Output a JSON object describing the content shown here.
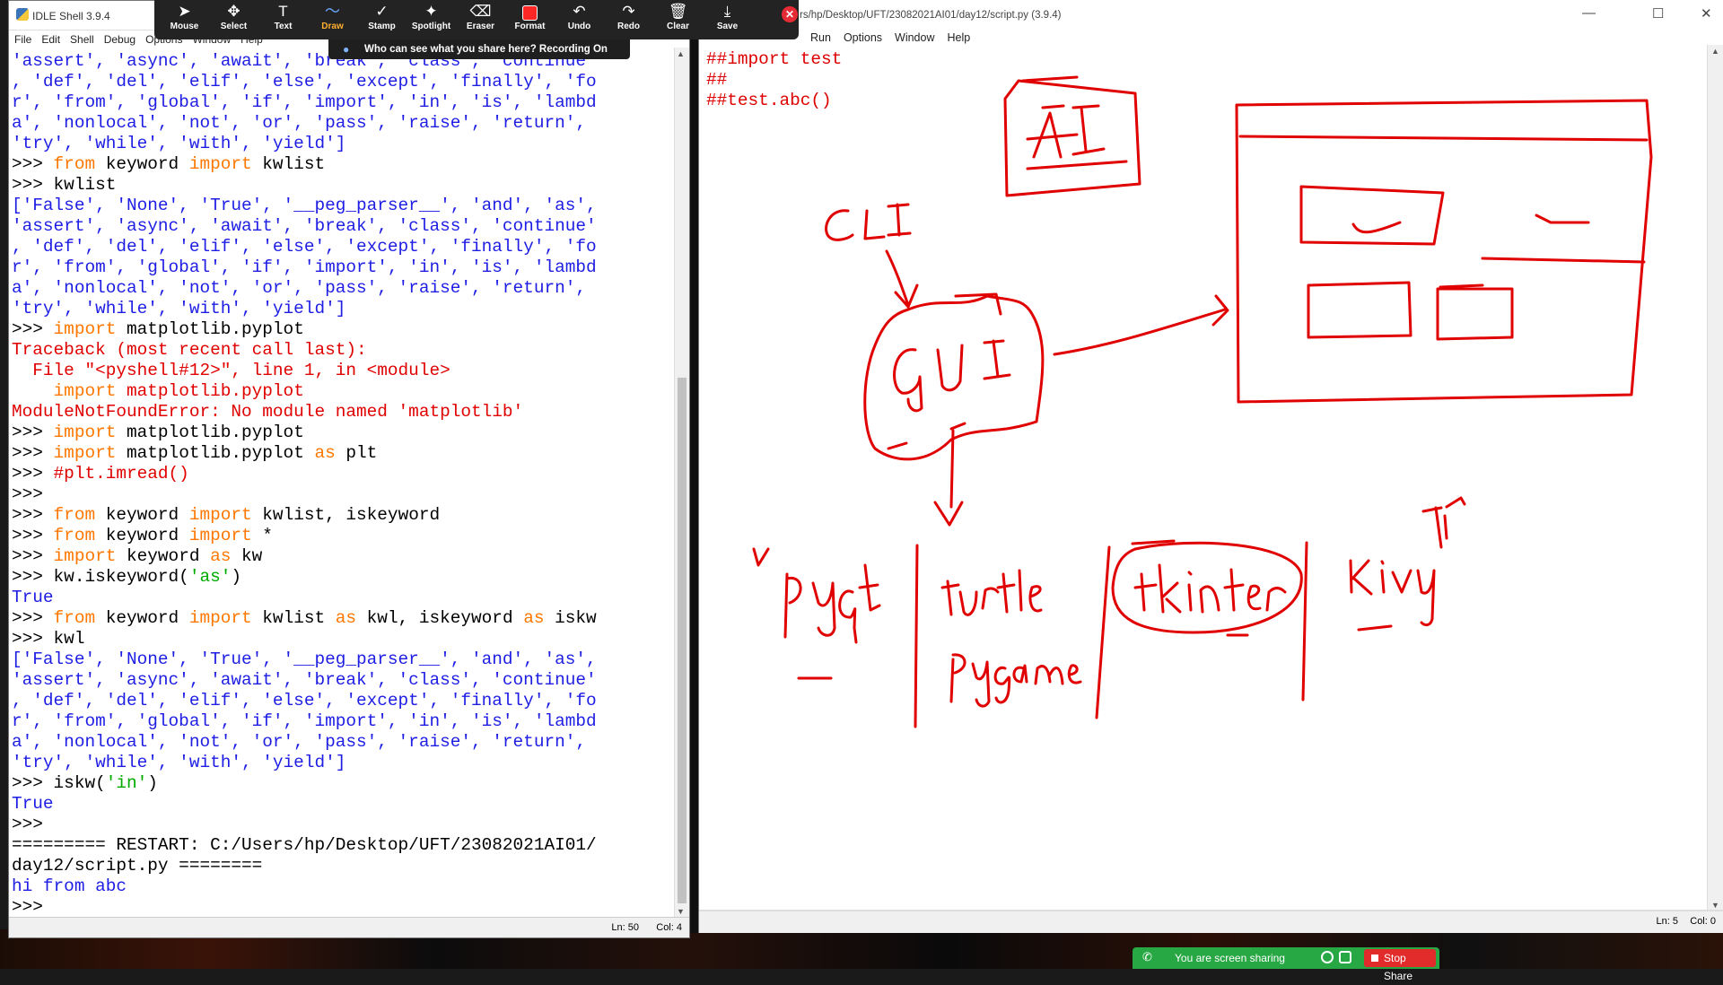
{
  "shell_window": {
    "title": "IDLE Shell 3.9.4",
    "menu": [
      "File",
      "Edit",
      "Shell",
      "Debug",
      "Options",
      "Window",
      "Help"
    ],
    "lines": [
      [
        {
          "t": "'assert', 'async', 'await', 'break', 'class', 'continue'",
          "c": "out"
        }
      ],
      [
        {
          "t": ", 'def', 'del', 'elif', 'else', 'except', 'finally', 'fo",
          "c": "out"
        }
      ],
      [
        {
          "t": "r', 'from', 'global', 'if', 'import', 'in', 'is', 'lambd",
          "c": "out"
        }
      ],
      [
        {
          "t": "a', 'nonlocal', 'not', 'or', 'pass', 'raise', 'return',",
          "c": "out"
        }
      ],
      [
        {
          "t": "'try', 'while', 'with', 'yield']",
          "c": "out"
        }
      ],
      [
        {
          "t": ">>> ",
          "c": "plain"
        },
        {
          "t": "from",
          "c": "kw"
        },
        {
          "t": " keyword ",
          "c": "plain"
        },
        {
          "t": "import",
          "c": "kw"
        },
        {
          "t": " kwlist",
          "c": "plain"
        }
      ],
      [
        {
          "t": ">>> kwlist",
          "c": "plain"
        }
      ],
      [
        {
          "t": "['False', 'None', 'True', '__peg_parser__', 'and', 'as',",
          "c": "out"
        }
      ],
      [
        {
          "t": "'assert', 'async', 'await', 'break', 'class', 'continue'",
          "c": "out"
        }
      ],
      [
        {
          "t": ", 'def', 'del', 'elif', 'else', 'except', 'finally', 'fo",
          "c": "out"
        }
      ],
      [
        {
          "t": "r', 'from', 'global', 'if', 'import', 'in', 'is', 'lambd",
          "c": "out"
        }
      ],
      [
        {
          "t": "a', 'nonlocal', 'not', 'or', 'pass', 'raise', 'return',",
          "c": "out"
        }
      ],
      [
        {
          "t": "'try', 'while', 'with', 'yield']",
          "c": "out"
        }
      ],
      [
        {
          "t": ">>> ",
          "c": "plain"
        },
        {
          "t": "import",
          "c": "kw"
        },
        {
          "t": " matplotlib.pyplot",
          "c": "plain"
        }
      ],
      [
        {
          "t": "Traceback (most recent call last):",
          "c": "err"
        }
      ],
      [
        {
          "t": "  File \"<pyshell#12>\", line 1, in <module>",
          "c": "err"
        }
      ],
      [
        {
          "t": "    ",
          "c": "plain"
        },
        {
          "t": "import",
          "c": "kw"
        },
        {
          "t": " matplotlib.pyplot",
          "c": "err"
        }
      ],
      [
        {
          "t": "ModuleNotFoundError: No module named 'matplotlib'",
          "c": "err"
        }
      ],
      [
        {
          "t": ">>> ",
          "c": "plain"
        },
        {
          "t": "import",
          "c": "kw"
        },
        {
          "t": " matplotlib.pyplot",
          "c": "plain"
        }
      ],
      [
        {
          "t": ">>> ",
          "c": "plain"
        },
        {
          "t": "import",
          "c": "kw"
        },
        {
          "t": " matplotlib.pyplot ",
          "c": "plain"
        },
        {
          "t": "as",
          "c": "kw"
        },
        {
          "t": " plt",
          "c": "plain"
        }
      ],
      [
        {
          "t": ">>> ",
          "c": "plain"
        },
        {
          "t": "#plt.imread()",
          "c": "err"
        }
      ],
      [
        {
          "t": ">>> ",
          "c": "plain"
        }
      ],
      [
        {
          "t": ">>> ",
          "c": "plain"
        },
        {
          "t": "from",
          "c": "kw"
        },
        {
          "t": " keyword ",
          "c": "plain"
        },
        {
          "t": "import",
          "c": "kw"
        },
        {
          "t": " kwlist, iskeyword",
          "c": "plain"
        }
      ],
      [
        {
          "t": ">>> ",
          "c": "plain"
        },
        {
          "t": "from",
          "c": "kw"
        },
        {
          "t": " keyword ",
          "c": "plain"
        },
        {
          "t": "import",
          "c": "kw"
        },
        {
          "t": " *",
          "c": "plain"
        }
      ],
      [
        {
          "t": ">>> ",
          "c": "plain"
        },
        {
          "t": "import",
          "c": "kw"
        },
        {
          "t": " keyword ",
          "c": "plain"
        },
        {
          "t": "as",
          "c": "kw"
        },
        {
          "t": " kw",
          "c": "plain"
        }
      ],
      [
        {
          "t": ">>> kw.iskeyword(",
          "c": "plain"
        },
        {
          "t": "'as'",
          "c": "str"
        },
        {
          "t": ")",
          "c": "plain"
        }
      ],
      [
        {
          "t": "True",
          "c": "out"
        }
      ],
      [
        {
          "t": ">>> ",
          "c": "plain"
        },
        {
          "t": "from",
          "c": "kw"
        },
        {
          "t": " keyword ",
          "c": "plain"
        },
        {
          "t": "import",
          "c": "kw"
        },
        {
          "t": " kwlist ",
          "c": "plain"
        },
        {
          "t": "as",
          "c": "kw"
        },
        {
          "t": " kwl, iskeyword ",
          "c": "plain"
        },
        {
          "t": "as",
          "c": "kw"
        },
        {
          "t": " iskw",
          "c": "plain"
        }
      ],
      [
        {
          "t": ">>> kwl",
          "c": "plain"
        }
      ],
      [
        {
          "t": "['False', 'None', 'True', '__peg_parser__', 'and', 'as',",
          "c": "out"
        }
      ],
      [
        {
          "t": "'assert', 'async', 'await', 'break', 'class', 'continue'",
          "c": "out"
        }
      ],
      [
        {
          "t": ", 'def', 'del', 'elif', 'else', 'except', 'finally', 'fo",
          "c": "out"
        }
      ],
      [
        {
          "t": "r', 'from', 'global', 'if', 'import', 'in', 'is', 'lambd",
          "c": "out"
        }
      ],
      [
        {
          "t": "a', 'nonlocal', 'not', 'or', 'pass', 'raise', 'return',",
          "c": "out"
        }
      ],
      [
        {
          "t": "'try', 'while', 'with', 'yield']",
          "c": "out"
        }
      ],
      [
        {
          "t": ">>> iskw(",
          "c": "plain"
        },
        {
          "t": "'in'",
          "c": "str"
        },
        {
          "t": ")",
          "c": "plain"
        }
      ],
      [
        {
          "t": "True",
          "c": "out"
        }
      ],
      [
        {
          "t": ">>> ",
          "c": "plain"
        }
      ],
      [
        {
          "t": "========= RESTART: C:/Users/hp/Desktop/UFT/23082021AI01/",
          "c": "plain"
        }
      ],
      [
        {
          "t": "day12/script.py ========",
          "c": "plain"
        }
      ],
      [
        {
          "t": "hi from abc",
          "c": "out"
        }
      ],
      [
        {
          "t": ">>> ",
          "c": "plain"
        }
      ]
    ],
    "status": {
      "ln": "Ln: 50",
      "col": "Col: 4"
    }
  },
  "editor_window": {
    "title": "rs/hp/Desktop/UFT/23082021AI01/day12/script.py (3.9.4)",
    "menu": [
      "Run",
      "Options",
      "Window",
      "Help"
    ],
    "code_lines": [
      "##import test",
      "##",
      "##test.abc()"
    ],
    "status": {
      "ln": "Ln: 5",
      "col": "Col: 0"
    }
  },
  "annotations": {
    "handwritten_labels": [
      "AI",
      "CLI",
      "GUI",
      "pyqt",
      "turtle",
      "pygame",
      "tkinter",
      "kivy"
    ],
    "ink_color": "#e00000"
  },
  "zoom_toolbar": {
    "tools": [
      {
        "label": "Mouse",
        "icon": "cursor-icon",
        "glyph": "➤"
      },
      {
        "label": "Select",
        "icon": "move-icon",
        "glyph": "✥"
      },
      {
        "label": "Text",
        "icon": "text-icon",
        "glyph": "T"
      },
      {
        "label": "Draw",
        "icon": "draw-icon",
        "glyph": "〜",
        "active": true
      },
      {
        "label": "Stamp",
        "icon": "stamp-icon",
        "glyph": "✓"
      },
      {
        "label": "Spotlight",
        "icon": "spotlight-icon",
        "glyph": "✦"
      },
      {
        "label": "Eraser",
        "icon": "eraser-icon",
        "glyph": "⌫"
      },
      {
        "label": "Format",
        "icon": "format-icon",
        "glyph": ""
      },
      {
        "label": "Undo",
        "icon": "undo-icon",
        "glyph": "↶"
      },
      {
        "label": "Redo",
        "icon": "redo-icon",
        "glyph": "↷"
      },
      {
        "label": "Clear",
        "icon": "trash-icon",
        "glyph": "🗑"
      },
      {
        "label": "Save",
        "icon": "save-icon",
        "glyph": "⤓"
      }
    ],
    "format_color": "#ff2626",
    "recording_banner": "Who can see what you share here? Recording On"
  },
  "share_bar": {
    "status_text": "You are screen sharing",
    "stop_label": "Stop Share"
  }
}
